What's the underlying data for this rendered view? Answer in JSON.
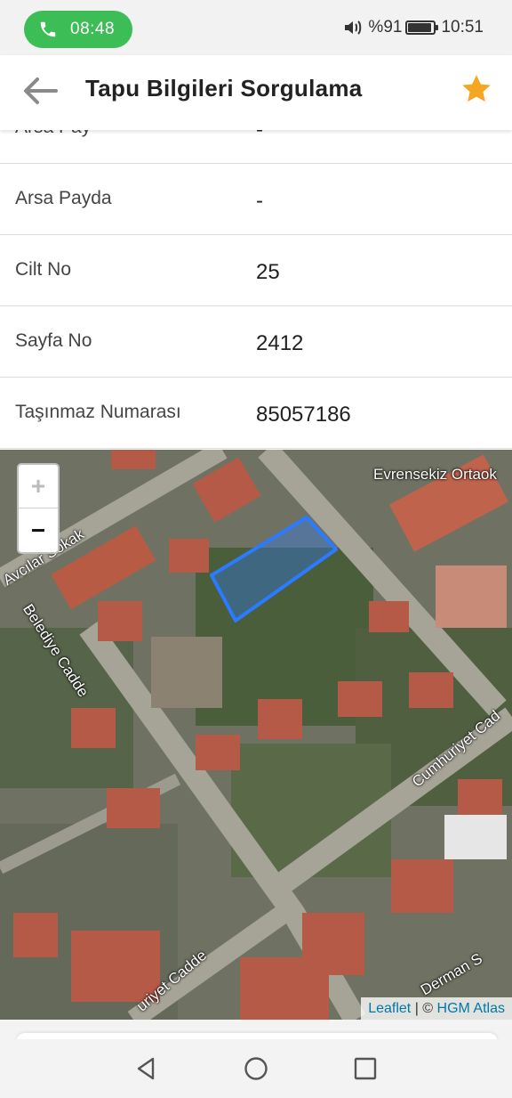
{
  "status_bar": {
    "call_time": "08:48",
    "battery": "%91",
    "clock": "10:51"
  },
  "app_bar": {
    "title": "Tapu Bilgileri Sorgulama",
    "back_icon": "arrow-left-icon",
    "favorite_icon": "star-icon",
    "accent_color": "#f5a623"
  },
  "rows": [
    {
      "label": "Arsa Pay",
      "value": "-"
    },
    {
      "label": "Arsa Payda",
      "value": "-"
    },
    {
      "label": "Cilt No",
      "value": "25"
    },
    {
      "label": "Sayfa No",
      "value": "2412"
    },
    {
      "label": "Taşınmaz Numarası",
      "value": "85057186"
    }
  ],
  "map": {
    "zoom_in": "+",
    "zoom_out": "−",
    "street_labels": [
      "Avcılar Sokak",
      "Belediye Cadde",
      "Evrensekiz Ortaok",
      "Cumhuriyet Cad",
      "uriyet Cadde",
      "Derman S"
    ],
    "parcel_color": "#2a7bff",
    "attribution": {
      "leaflet": "Leaflet",
      "separator": " | © ",
      "provider": "HGM Atlas"
    }
  },
  "nav_bar": {
    "back_icon": "nav-back-icon",
    "home_icon": "nav-home-icon",
    "recents_icon": "nav-recents-icon"
  }
}
